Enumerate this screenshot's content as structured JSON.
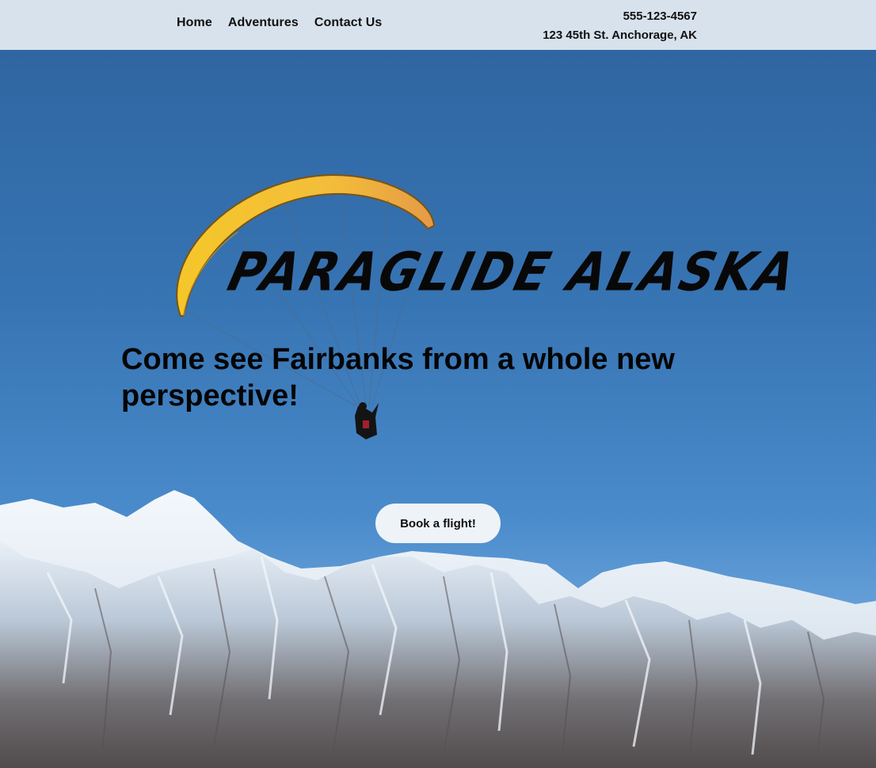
{
  "nav": {
    "items": [
      {
        "label": "Home"
      },
      {
        "label": "Adventures"
      },
      {
        "label": "Contact Us"
      }
    ]
  },
  "contact": {
    "phone": "555-123-4567",
    "address": "123 45th St. Anchorage, AK"
  },
  "hero": {
    "brand": "Paraglide Alaska",
    "tagline": "Come see Fairbanks from a whole new perspective!",
    "cta_label": "Book a flight!"
  },
  "colors": {
    "topbar": "#d8e2ec",
    "sky_top": "#2f66a2",
    "sky_bottom": "#7eb2e2",
    "canopy": "#f2c12e",
    "cta_bg": "#eef3f8"
  }
}
